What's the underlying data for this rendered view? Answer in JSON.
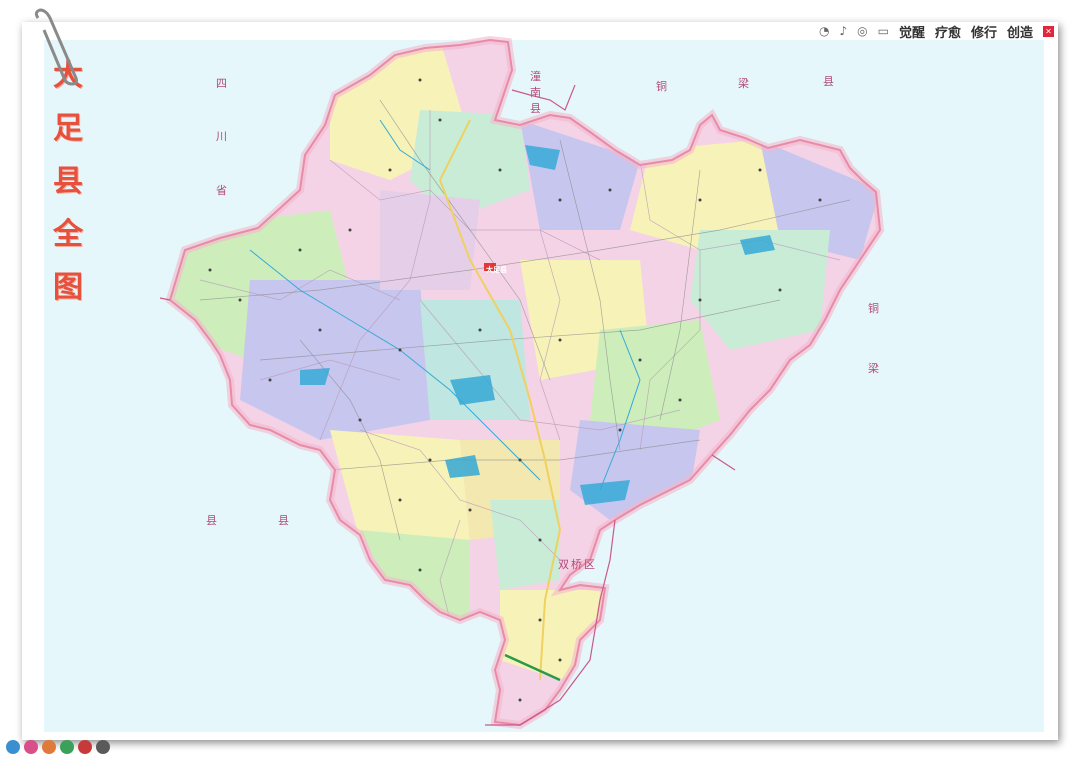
{
  "topbar": {
    "icons": [
      "wechat-icon",
      "tiktok-icon",
      "weibo-icon",
      "bilibili-icon"
    ],
    "words": [
      "觉醒",
      "疗愈",
      "修行",
      "创造"
    ]
  },
  "title_chars": [
    "大",
    "足",
    "县",
    "全",
    "图"
  ],
  "neighbors": {
    "sichuan": [
      "四",
      "川",
      "省"
    ],
    "tongnan": [
      "潼",
      "南",
      "县"
    ],
    "tongliang": [
      "铜",
      "梁",
      "县"
    ],
    "tongliang_right": [
      "铜",
      "梁"
    ],
    "rong": [
      "县",
      "县"
    ],
    "shuangqiao": "双桥区"
  },
  "county_seat": "大足县",
  "colors": {
    "sea": "#e6f7fb",
    "border": "#e88aa8",
    "title": "#e6503c",
    "road": "#f0d060",
    "water": "#36a9d6",
    "regions": [
      "#f5d3e6",
      "#f7f3b8",
      "#c8ecd6",
      "#c7c6ee",
      "#bfe6e0",
      "#f2e8b0",
      "#e5cfe8",
      "#cdeebb"
    ]
  }
}
